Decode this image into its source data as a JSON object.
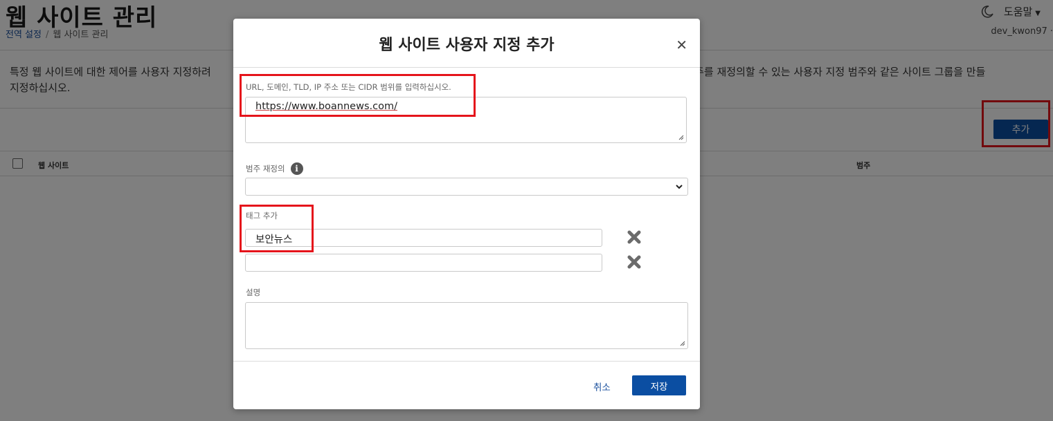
{
  "page": {
    "title": "웹 사이트 관리",
    "breadcrumb": [
      "전역 설정",
      "웹 사이트 관리"
    ],
    "help_label": "도움말",
    "user": "dev_kwon97 ·",
    "description_line1": "특정 웹 사이트에 대한 제어를 사용자 지정하려                                                                                                                                         hos 범주를 재정의할 수 있는 사용자 지정 범주와 같은 사이트 그룹을 만들",
    "description_line2": "지정하십시오.",
    "add_button": "추가",
    "table_headers": {
      "website": "웹 사이트",
      "category": "범주"
    }
  },
  "modal": {
    "title": "웹 사이트 사용자 지정 추가",
    "url_label": "URL, 도메인, TLD, IP 주소 또는 CIDR 범위를 입력하십시오.",
    "url_value": "https://www.boannews.com/",
    "category_override_label": "범주 재정의",
    "category_value": "",
    "tag_label": "태그 추가",
    "tags": [
      "보안뉴스",
      ""
    ],
    "description_label": "설명",
    "description_value": "",
    "cancel_label": "취소",
    "save_label": "저장"
  },
  "colors": {
    "primary": "#0b4ea2",
    "highlight": "#e5141b",
    "link": "#1a4f9c"
  }
}
